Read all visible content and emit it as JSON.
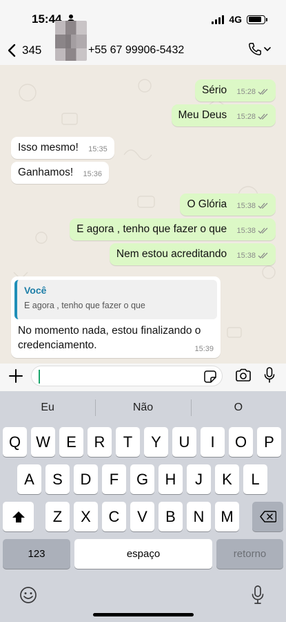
{
  "status_bar": {
    "time": "15:44",
    "network": "4G"
  },
  "header": {
    "back_count": "345",
    "contact": "+55 67 99906-5432"
  },
  "messages": [
    {
      "text": "Sério",
      "time": "15:28",
      "dir": "out"
    },
    {
      "text": "Meu Deus",
      "time": "15:28",
      "dir": "out"
    },
    {
      "text": "Isso mesmo!",
      "time": "15:35",
      "dir": "in"
    },
    {
      "text": "Ganhamos!",
      "time": "15:36",
      "dir": "in"
    },
    {
      "text": "O Glória",
      "time": "15:38",
      "dir": "out"
    },
    {
      "text": "E agora , tenho que fazer o que",
      "time": "15:38",
      "dir": "out"
    },
    {
      "text": "Nem estou acreditando",
      "time": "15:38",
      "dir": "out"
    }
  ],
  "reply": {
    "author": "Você",
    "quoted": "E agora , tenho que fazer o que",
    "line1": "No momento nada, estou finalizando o",
    "line2": "credenciamento.",
    "time": "15:39"
  },
  "keyboard": {
    "suggestions": [
      "Eu",
      "Não",
      "O"
    ],
    "row1": [
      "Q",
      "W",
      "E",
      "R",
      "T",
      "Y",
      "U",
      "I",
      "O",
      "P"
    ],
    "row2": [
      "A",
      "S",
      "D",
      "F",
      "G",
      "H",
      "J",
      "K",
      "L"
    ],
    "row3": [
      "Z",
      "X",
      "C",
      "V",
      "B",
      "N",
      "M"
    ],
    "numbers": "123",
    "space": "espaço",
    "return": "retorno"
  },
  "colors": {
    "outgoing": "#dcf8c6",
    "incoming": "#ffffff",
    "chat_bg": "#efeae2",
    "accent": "#1aa56b"
  }
}
